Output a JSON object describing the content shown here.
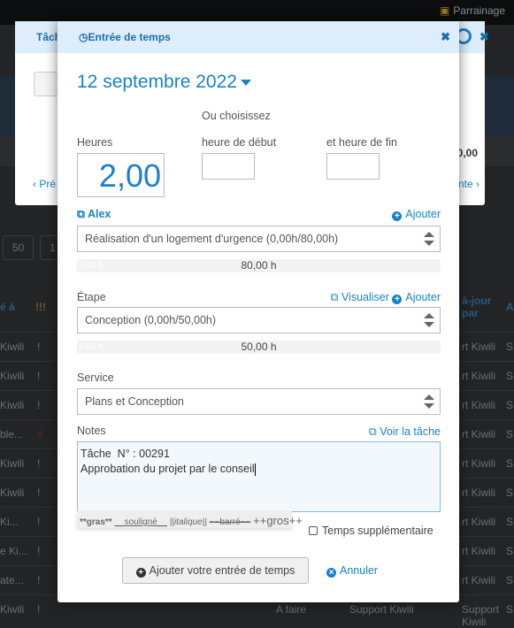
{
  "background": {
    "topbar": {
      "referral_label": "Parrainage"
    },
    "pager": [
      "50",
      "1"
    ],
    "table_headers": {
      "assigned": "é à",
      "priority": "!!!",
      "updated_by": "à-jour par",
      "last": "A"
    },
    "rows": [
      {
        "assigned": "Kiwili",
        "priority": "!",
        "updated_by": "rt Kiwili",
        "last": "S"
      },
      {
        "assigned": "Kiwili",
        "priority": "!",
        "updated_by": "rt Kiwili",
        "last": "S"
      },
      {
        "assigned": "Kiwili",
        "priority": "!",
        "updated_by": "rt Kiwili",
        "last": "S"
      },
      {
        "assigned": "ble...",
        "priority": "!!",
        "updated_by": "rt Kiwili",
        "last": "S"
      },
      {
        "assigned": "Kiwili",
        "priority": "!",
        "updated_by": "rt Kiwili",
        "last": "S"
      },
      {
        "assigned": "Kiwili",
        "priority": "!",
        "updated_by": "rt Kiwili",
        "last": "S"
      },
      {
        "assigned": "Ki...",
        "priority": "!",
        "updated_by": "rt Kiwili",
        "last": "S"
      },
      {
        "assigned": "e Ki...",
        "priority": "!",
        "updated_by": "rt Kiwili",
        "last": "S"
      },
      {
        "assigned": "ate...",
        "priority": "!",
        "updated_by": "rt Kiwili",
        "last": "S"
      },
      {
        "assigned": "Kiwili",
        "priority": "!",
        "status": "A faire",
        "owner": "Support Kiwili",
        "updated_by": "Support Kiwili",
        "last": "S"
      }
    ]
  },
  "back_modal": {
    "title": "Tâch",
    "total": "0,00",
    "prev": "Pré",
    "next": "nte"
  },
  "modal": {
    "title": "Entrée de temps",
    "date": "12 septembre 2022",
    "or_choose": "Ou choisissez",
    "hours_label": "Heures",
    "hours_value": "2,00",
    "start_label": "heure de début",
    "end_label": "et heure de fin",
    "start_value": "",
    "end_value": "",
    "project": {
      "owner_link": "Alex",
      "add": "Ajouter",
      "selected": "Réalisation d'un logement d'urgence (0,00h/80,00h)",
      "progress_used": "0,00 h",
      "progress_total": "80,00 h",
      "progress_fraction": 0
    },
    "stage": {
      "label": "Étape",
      "view": "Visualiser",
      "add": "Ajouter",
      "selected": "Conception (0,00h/50,00h)",
      "progress_used": "0,00 h",
      "progress_total": "50,00 h",
      "progress_fraction": 0
    },
    "service": {
      "label": "Service",
      "selected": "Plans et Conception"
    },
    "notes": {
      "label": "Notes",
      "view_task": "Voir la tâche",
      "value": "Tâche  N° : 00291\nApprobation du projet par le conseil"
    },
    "format_hint": {
      "bold": "**gras**",
      "underline": "__souligné__",
      "italic": "||italique||",
      "strike": "~~barré~~",
      "big": "++gros++"
    },
    "overtime_label": "Temps supplémentaire",
    "overtime_checked": false,
    "submit": "Ajouter votre entrée de temps",
    "cancel": "Annuler"
  }
}
